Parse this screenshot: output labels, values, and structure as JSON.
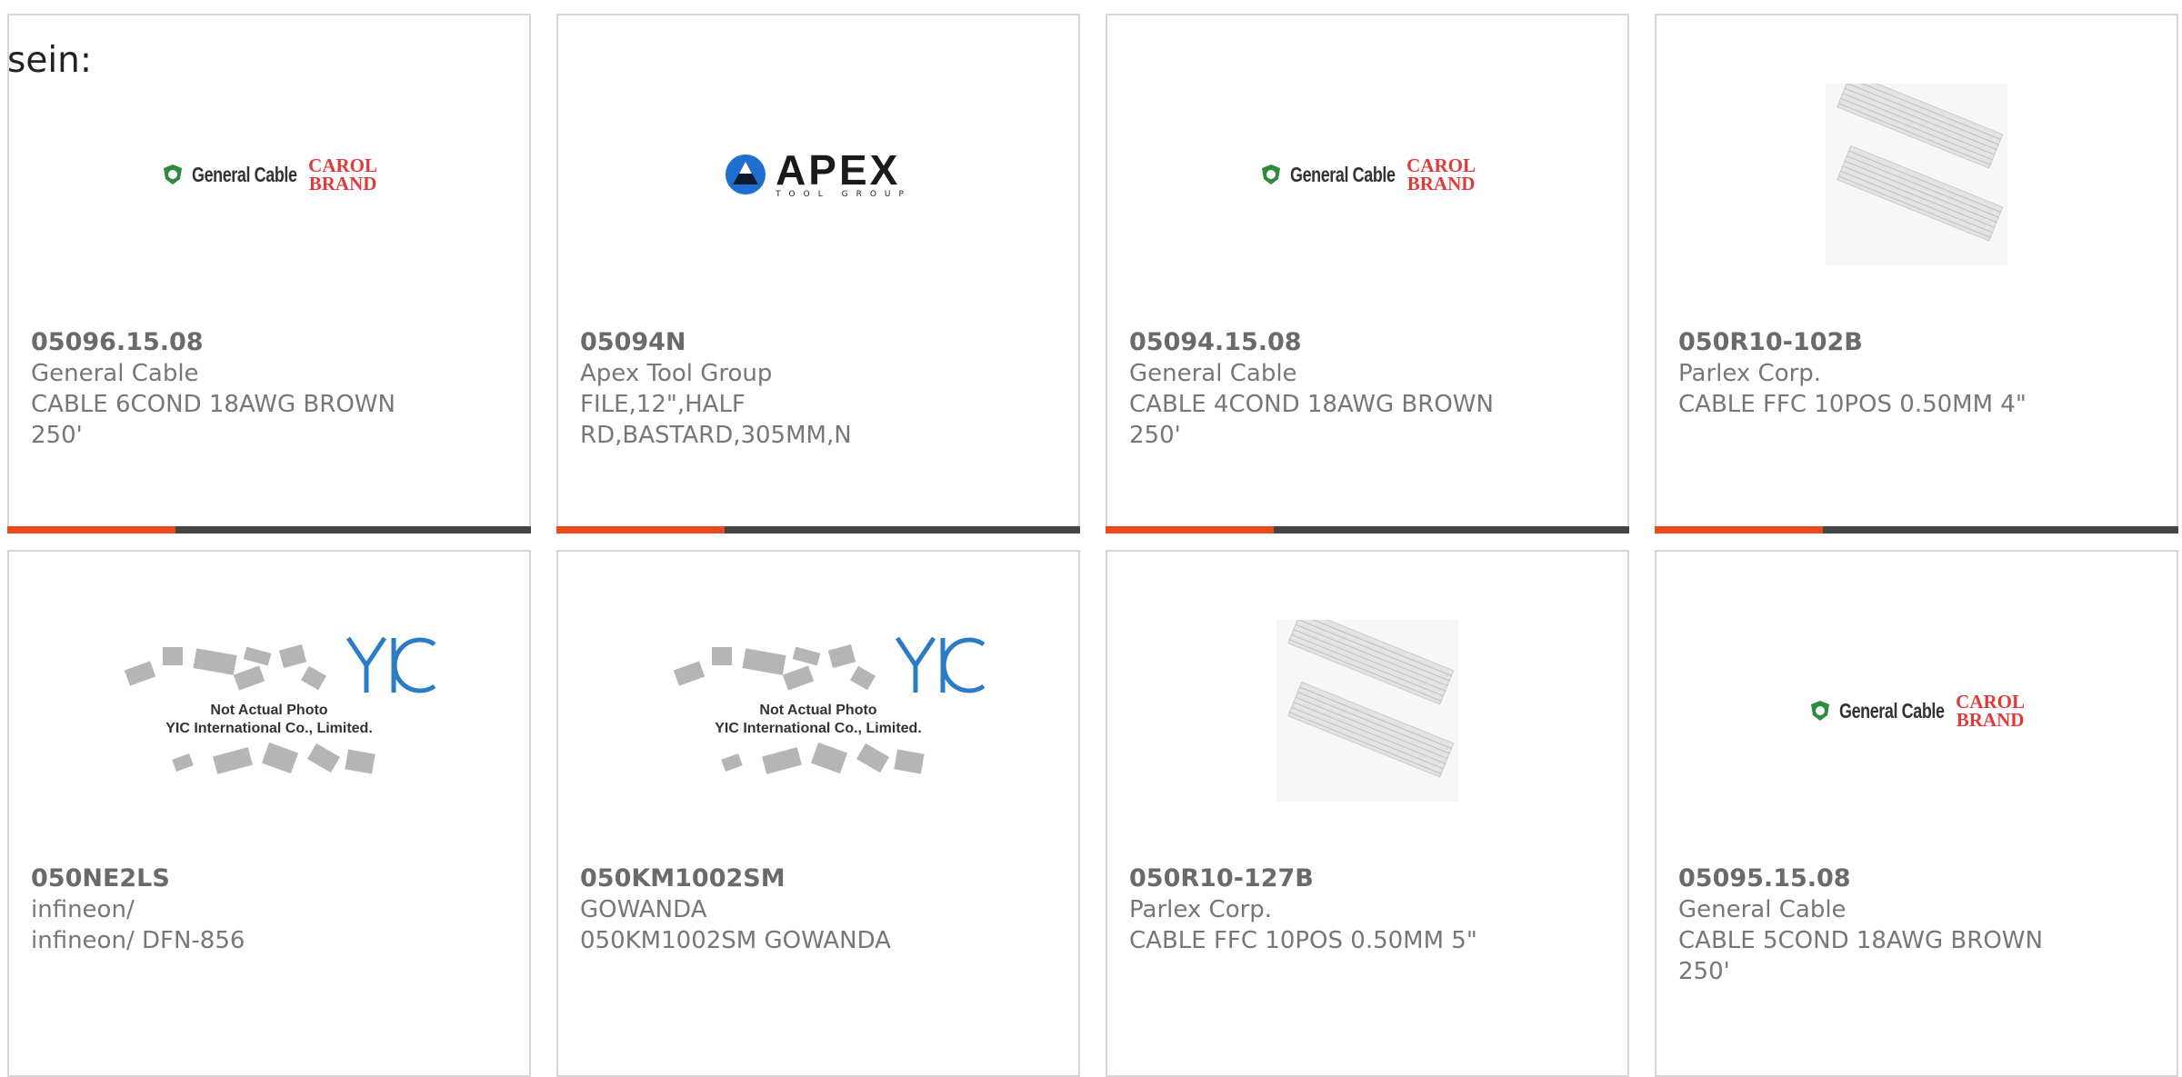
{
  "intro_text": "sein:",
  "products": [
    {
      "part_number": "05096.15.08",
      "manufacturer": "General Cable",
      "description": "CABLE 6COND 18AWG BROWN 250'",
      "image": "general-cable-carol-brand-logo"
    },
    {
      "part_number": "05094N",
      "manufacturer": "Apex Tool Group",
      "description": "FILE,12\",HALF RD,BASTARD,305MM,N",
      "image": "apex-tool-group-logo"
    },
    {
      "part_number": "05094.15.08",
      "manufacturer": "General Cable",
      "description": "CABLE 4COND 18AWG BROWN 250'",
      "image": "general-cable-carol-brand-logo"
    },
    {
      "part_number": "050R10-102B",
      "manufacturer": "Parlex Corp.",
      "description": "CABLE FFC 10POS 0.50MM 4\"",
      "image": "ffc-cable-photo"
    },
    {
      "part_number": "050NE2LS",
      "manufacturer": "infineon/",
      "description": "infineon/ DFN-856",
      "image": "yic-placeholder"
    },
    {
      "part_number": "050KM1002SM",
      "manufacturer": "GOWANDA",
      "description": "050KM1002SM GOWANDA",
      "image": "yic-placeholder"
    },
    {
      "part_number": "050R10-127B",
      "manufacturer": "Parlex Corp.",
      "description": "CABLE FFC 10POS 0.50MM 5\"",
      "image": "ffc-cable-photo"
    },
    {
      "part_number": "05095.15.08",
      "manufacturer": "General Cable",
      "description": "CABLE 5COND 18AWG BROWN 250'",
      "image": "general-cable-carol-brand-logo"
    }
  ],
  "logos": {
    "general_cable": "General Cable",
    "carol_line1": "CAROL",
    "carol_line2": "BRAND",
    "apex_word": "APEX",
    "apex_sub": "TOOL GROUP",
    "yic_mark": "YIC",
    "yic_line1": "Not Actual Photo",
    "yic_line2": "YIC International Co., Limited."
  },
  "colors": {
    "accent": "#ea4a1e",
    "bar_dark": "#444444",
    "card_border": "#d6d6d6"
  }
}
